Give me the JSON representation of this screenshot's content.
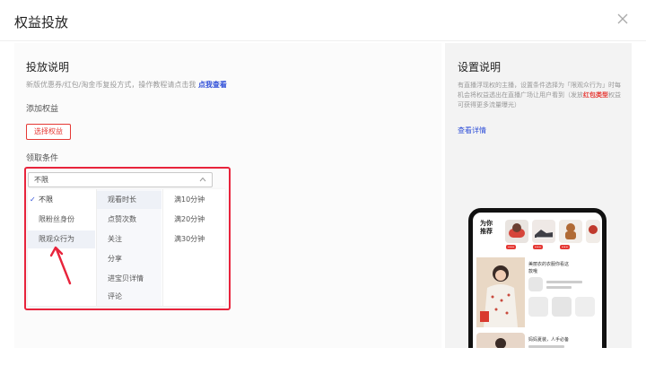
{
  "dialog": {
    "title": "权益投放"
  },
  "left": {
    "section_title": "投放说明",
    "desc_text": "新版优惠券/红包/淘金币复投方式，操作教程请点击我",
    "desc_link": "点我查看",
    "add_label": "添加权益",
    "select_button": "选择权益",
    "condition_label": "领取条件",
    "select_value": "不限",
    "dropdown": {
      "col1": [
        {
          "label": "不限",
          "checked": true
        },
        {
          "label": "限粉丝身份",
          "checked": false
        },
        {
          "label": "限观众行为",
          "checked": false
        }
      ],
      "col2": [
        "观看时长",
        "点赞次数",
        "关注",
        "分享",
        "进宝贝详情",
        "评论"
      ],
      "col3": [
        "满10分钟",
        "满20分钟",
        "满30分钟"
      ]
    }
  },
  "right": {
    "section_title": "设置说明",
    "desc_before": "有直播浮现权的主播，设置条件选择为「限观众行为」时每机会将权益透出在直播广场让用户看到（发放",
    "desc_highlight": "红包类型",
    "desc_after": "权益可获得更多流量曝光）",
    "link": "查看详情",
    "phone": {
      "title_line1": "为你",
      "title_line2": "推荐",
      "card1_title": "美丽衣的衣服你看这",
      "card1_title2": "款哦",
      "card2_title": "妈妈夏装，人手必备"
    }
  },
  "colors": {
    "accent_red": "#e53935",
    "link_blue": "#2f4fd8",
    "highlight_border": "#e8243c"
  }
}
